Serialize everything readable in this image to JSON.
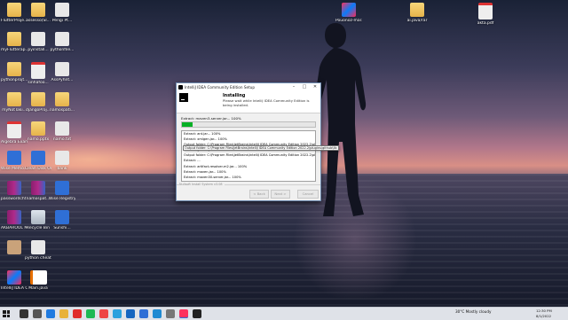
{
  "desktop_icons": [
    {
      "label": "FlutterProje...",
      "icon": "folder-icon"
    },
    {
      "label": "assesso(Sl...",
      "icon": "folder-icon"
    },
    {
      "label": "Pengi Pt...",
      "icon": "file-icon"
    },
    {
      "label": "myFlutterap...",
      "icon": "folder-icon"
    },
    {
      "label": "pyinstall...",
      "icon": "file-icon"
    },
    {
      "label": "pythonfile...",
      "icon": "file-icon"
    },
    {
      "label": "pythonprojt...",
      "icon": "folder-icon"
    },
    {
      "label": "sinhafoo...",
      "icon": "pdf-icon"
    },
    {
      "label": "AssPyhnt...",
      "icon": "file-icon"
    },
    {
      "label": "myNotTaki...",
      "icon": "folder-icon"
    },
    {
      "label": "djangoProj...",
      "icon": "folder-icon"
    },
    {
      "label": "namospati...",
      "icon": "folder-icon"
    },
    {
      "label": "Algebra Exam 2013...",
      "icon": "pdf-icon"
    },
    {
      "label": "namo.pptx",
      "icon": "folder-icon"
    },
    {
      "label": "namo.txt",
      "icon": "file-icon"
    },
    {
      "label": "Wise Memo...",
      "icon": "app-icon"
    },
    {
      "label": "Clean Disk One Click",
      "icon": "app-icon"
    },
    {
      "label": "bank",
      "icon": "file-icon"
    },
    {
      "label": "passwordcht...",
      "icon": "winrar-icon"
    },
    {
      "label": "namospat...",
      "icon": "winrar-icon"
    },
    {
      "label": "Wise Registry Cleaner",
      "icon": "app-icon"
    },
    {
      "label": "AKBAROOL MUXMYOL...",
      "icon": "winrar-icon"
    },
    {
      "label": "Recycle Bin",
      "icon": "recycle-bin-icon"
    },
    {
      "label": "Sunshi...",
      "icon": "app-icon"
    },
    {
      "label": "",
      "icon": "avatar-icon"
    },
    {
      "label": "python cheat sheet",
      "icon": "file-icon"
    },
    {
      "label": "IntelliJ IDEA Communi...",
      "icon": "intellij-icon"
    },
    {
      "label": "Main.java",
      "icon": "java-icon"
    },
    {
      "label": "Pouonoz-mar.ZipJ...",
      "icon": "intellij-icon"
    },
    {
      "label": "ai.java/rar",
      "icon": "folder-icon"
    },
    {
      "label": "akta.pdf",
      "icon": "pdf-icon"
    }
  ],
  "dialog": {
    "title": "IntelliJ IDEA Community Edition Setup",
    "minimize": "–",
    "maximize": "□",
    "close": "✕",
    "header_title": "Installing",
    "header_subtitle": "Please wait while IntelliJ IDEA Community Edition is being installed.",
    "current_action": "Extract: maven3-server.jar... 100%",
    "progress": 0.08,
    "log_lines": [
      "Extract: ant.jar... 100%",
      "Extract: xmlgen.jar... 100%",
      "Output folder: C:\\Program Files\\JetBrains\\IntelliJ IDEA Community Edition 2022.2\\plu...",
      "Extract: github.jar... 100%",
      "Output folder: C:\\Program Files\\JetBrains\\IntelliJ IDEA Community Edition 2022.2\\plu...",
      "Extract: ...",
      "Extract: artifact-resolver-m2.jar... 100%",
      "Extract: maven.jar... 100%",
      "Extract: maven30-server.jar... 100%",
      "Extract: maven3-server-common.jar... 100%",
      "Extract: maven3-server.jar... 100%"
    ],
    "tooltip": "Output folder: C:\\Program Files\\JetBrains\\IntelliJ IDEA Community Edition 2022.2\\plugins\\github\\lib",
    "brand": "Nullsoft Install System v3.08",
    "back_label": "< Back",
    "next_label": "Next >",
    "cancel_label": "Cancel"
  },
  "taskbar": {
    "weather": "30°C  Mostly cloudy",
    "time": "12:30 PM",
    "date": "8/1/2022",
    "icons": [
      "search-icon",
      "task-view-icon",
      "edge-icon",
      "file-explorer-icon",
      "youtube-icon",
      "spotify-icon",
      "chrome-icon",
      "telegram-icon",
      "mail-icon",
      "store-icon",
      "vscode-icon",
      "settings-icon",
      "intellij-icon",
      "terminal-icon"
    ]
  }
}
